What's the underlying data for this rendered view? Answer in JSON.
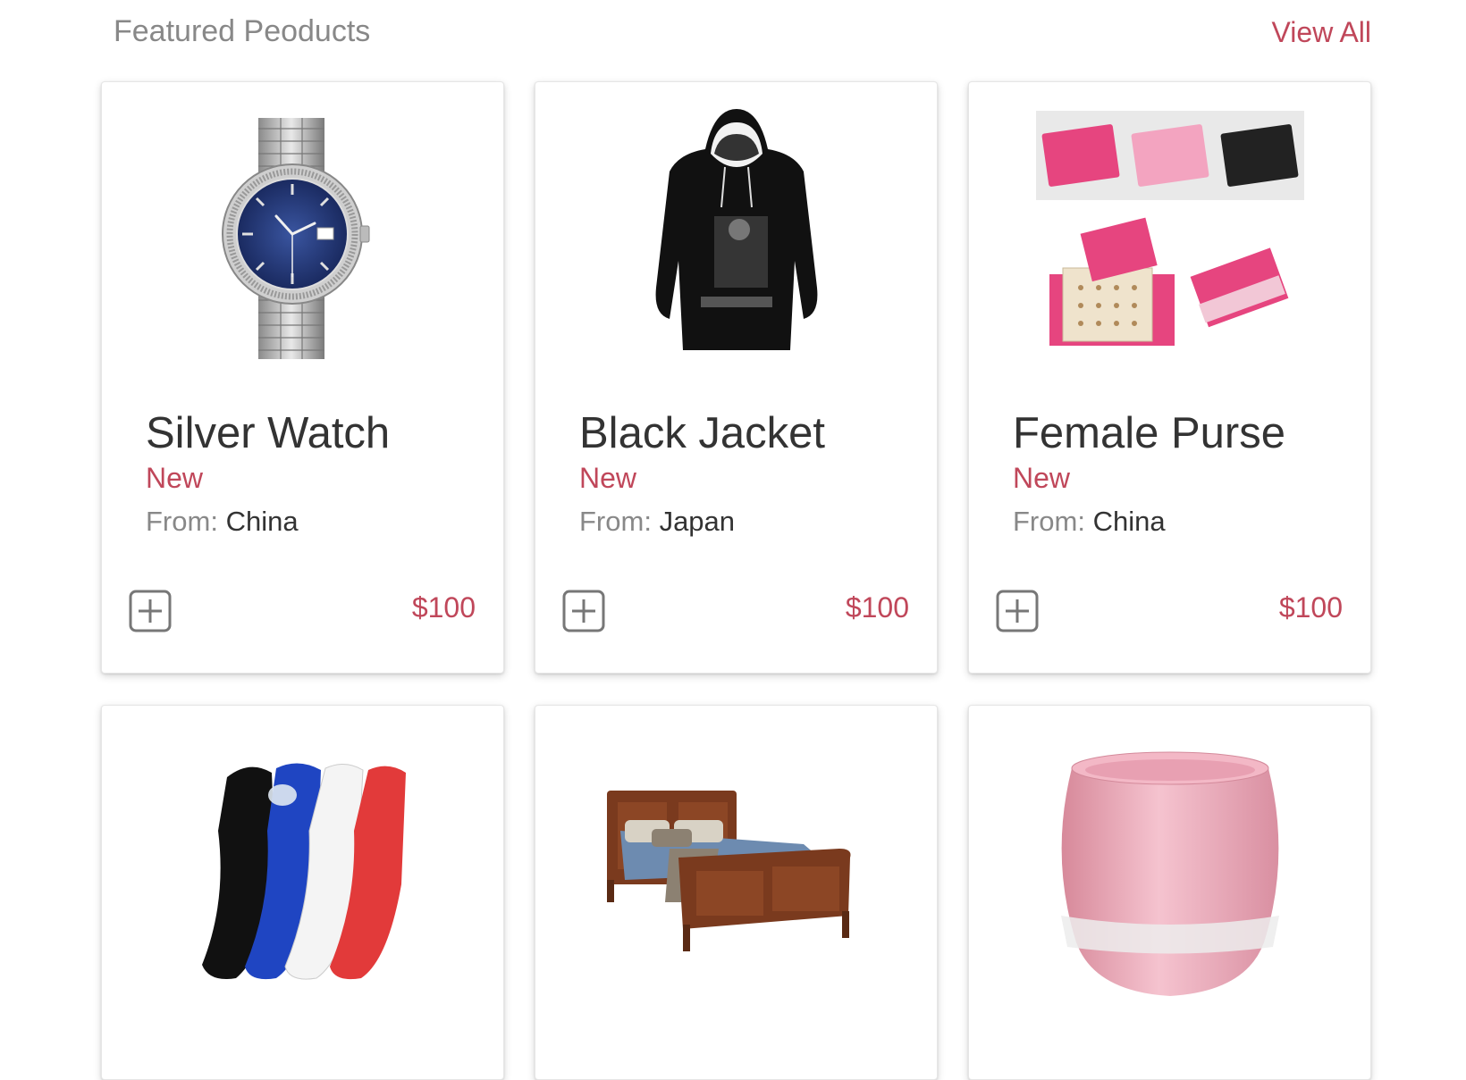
{
  "section": {
    "title": "Featured Peoducts",
    "view_all": "View All"
  },
  "products": [
    {
      "name": "Silver Watch",
      "condition": "New",
      "from_label": "From:",
      "country": "China",
      "price": "$100",
      "image_icon": "silver-watch-image"
    },
    {
      "name": "Black Jacket",
      "condition": "New",
      "from_label": "From:",
      "country": "Japan",
      "price": "$100",
      "image_icon": "black-hoodie-image"
    },
    {
      "name": "Female Purse",
      "condition": "New",
      "from_label": "From:",
      "country": "China",
      "price": "$100",
      "image_icon": "pink-jewelry-case-image"
    },
    {
      "image_icon": "knee-pads-image"
    },
    {
      "image_icon": "wooden-bed-image"
    },
    {
      "image_icon": "pink-vase-image"
    }
  ],
  "colors": {
    "accent": "#c0475a",
    "muted_text": "#888888",
    "dark_text": "#333333"
  }
}
